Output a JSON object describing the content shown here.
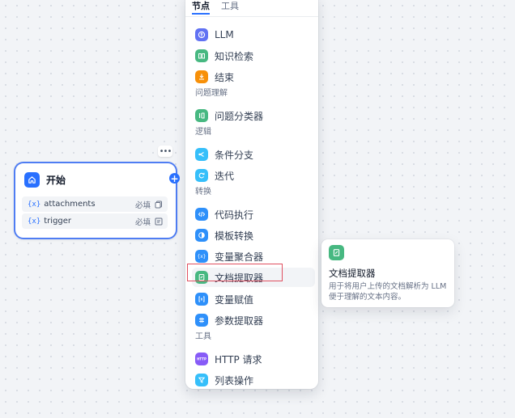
{
  "start_node": {
    "title": "开始",
    "more_label": "•••",
    "add_label": "+",
    "variables": [
      {
        "icon": "{x}",
        "name": "attachments",
        "required": "必填",
        "type_icon": "file-list-icon"
      },
      {
        "icon": "{x}",
        "name": "trigger",
        "required": "必填",
        "type_icon": "text-input-icon"
      }
    ]
  },
  "panel": {
    "tabs": [
      {
        "label": "节点",
        "active": true
      },
      {
        "label": "工具",
        "active": false
      }
    ],
    "items": [
      {
        "label": "LLM",
        "icon": "llm-icon",
        "color": "#6172f3"
      },
      {
        "label": "知识检索",
        "icon": "knowledge-retrieval-icon",
        "color": "#47b881"
      },
      {
        "label": "结束",
        "icon": "end-icon",
        "color": "#f79009"
      },
      {
        "label": "问题分类器",
        "icon": "question-classifier-icon",
        "color": "#47b881"
      },
      {
        "label": "条件分支",
        "icon": "if-else-icon",
        "color": "#36bffa"
      },
      {
        "label": "迭代",
        "icon": "iteration-icon",
        "color": "#36bffa"
      },
      {
        "label": "代码执行",
        "icon": "code-icon",
        "color": "#2e90fa"
      },
      {
        "label": "模板转换",
        "icon": "template-transform-icon",
        "color": "#2e90fa"
      },
      {
        "label": "变量聚合器",
        "icon": "variable-aggregator-icon",
        "color": "#2e90fa"
      },
      {
        "label": "文档提取器",
        "icon": "document-extractor-icon",
        "color": "#47b881"
      },
      {
        "label": "变量赋值",
        "icon": "variable-assigner-icon",
        "color": "#2e90fa"
      },
      {
        "label": "参数提取器",
        "icon": "parameter-extractor-icon",
        "color": "#2e90fa"
      },
      {
        "label": "HTTP 请求",
        "icon": "http-request-icon",
        "color": "#875bf7"
      },
      {
        "label": "列表操作",
        "icon": "list-operator-icon",
        "color": "#36bffa"
      }
    ],
    "sections": [
      "问题理解",
      "逻辑",
      "转换",
      "工具"
    ]
  },
  "tooltip": {
    "title": "文档提取器",
    "description": "用于将用户上传的文档解析为 LLM 便于理解的文本内容。",
    "icon": "document-extractor-icon"
  },
  "colors": {
    "accent": "#2970ff",
    "highlight": "#e04f5f"
  }
}
